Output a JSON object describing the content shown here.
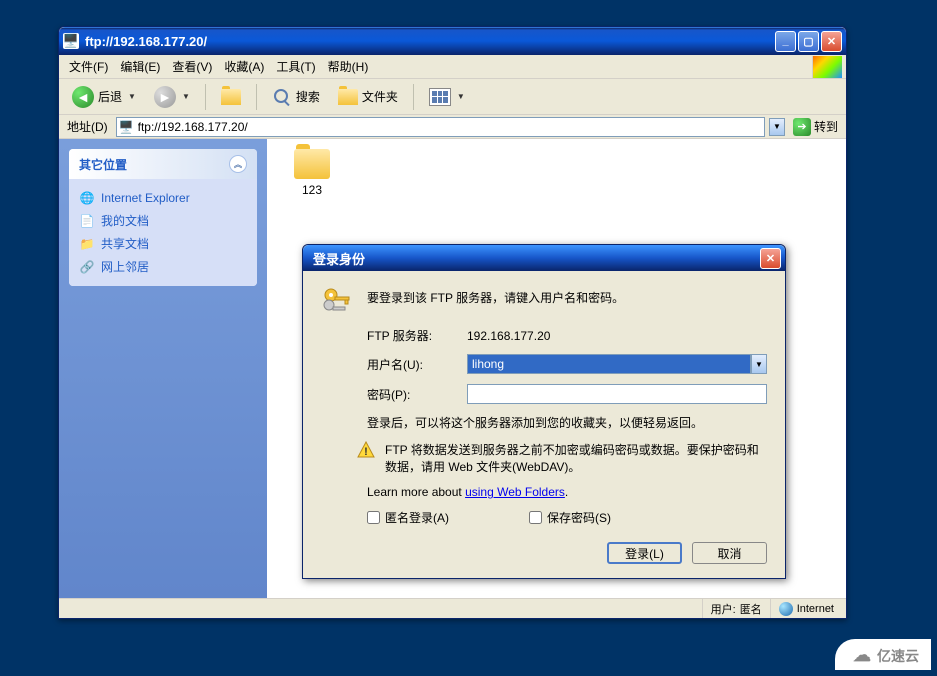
{
  "window": {
    "title": "ftp://192.168.177.20/",
    "folder_name": "123"
  },
  "menu": {
    "file": "文件(F)",
    "edit": "编辑(E)",
    "view": "查看(V)",
    "favorites": "收藏(A)",
    "tools": "工具(T)",
    "help": "帮助(H)"
  },
  "toolbar": {
    "back": "后退",
    "search": "搜索",
    "folders": "文件夹"
  },
  "address": {
    "label": "地址(D)",
    "value": "ftp://192.168.177.20/",
    "go": "转到"
  },
  "sidebar": {
    "header": "其它位置",
    "items": [
      {
        "icon": "ie",
        "label": "Internet Explorer"
      },
      {
        "icon": "doc",
        "label": "我的文档"
      },
      {
        "icon": "folder",
        "label": "共享文档"
      },
      {
        "icon": "net",
        "label": "网上邻居"
      }
    ]
  },
  "status": {
    "user_label": "用户:",
    "user_value": "匿名",
    "zone": "Internet"
  },
  "dialog": {
    "title": "登录身份",
    "intro": "要登录到该 FTP 服务器，请键入用户名和密码。",
    "server_label": "FTP 服务器:",
    "server_value": "192.168.177.20",
    "username_label": "用户名(U):",
    "username_value": "lihong",
    "password_label": "密码(P):",
    "password_value": "",
    "after_login": "登录后，可以将这个服务器添加到您的收藏夹，以便轻易返回。",
    "warning": "FTP 将数据发送到服务器之前不加密或编码密码或数据。要保护密码和数据，请用 Web 文件夹(WebDAV)。",
    "learn_prefix": "Learn more about ",
    "learn_link": "using Web Folders",
    "anonymous": "匿名登录(A)",
    "save_password": "保存密码(S)",
    "login_btn": "登录(L)",
    "cancel_btn": "取消"
  },
  "watermark": "亿速云"
}
